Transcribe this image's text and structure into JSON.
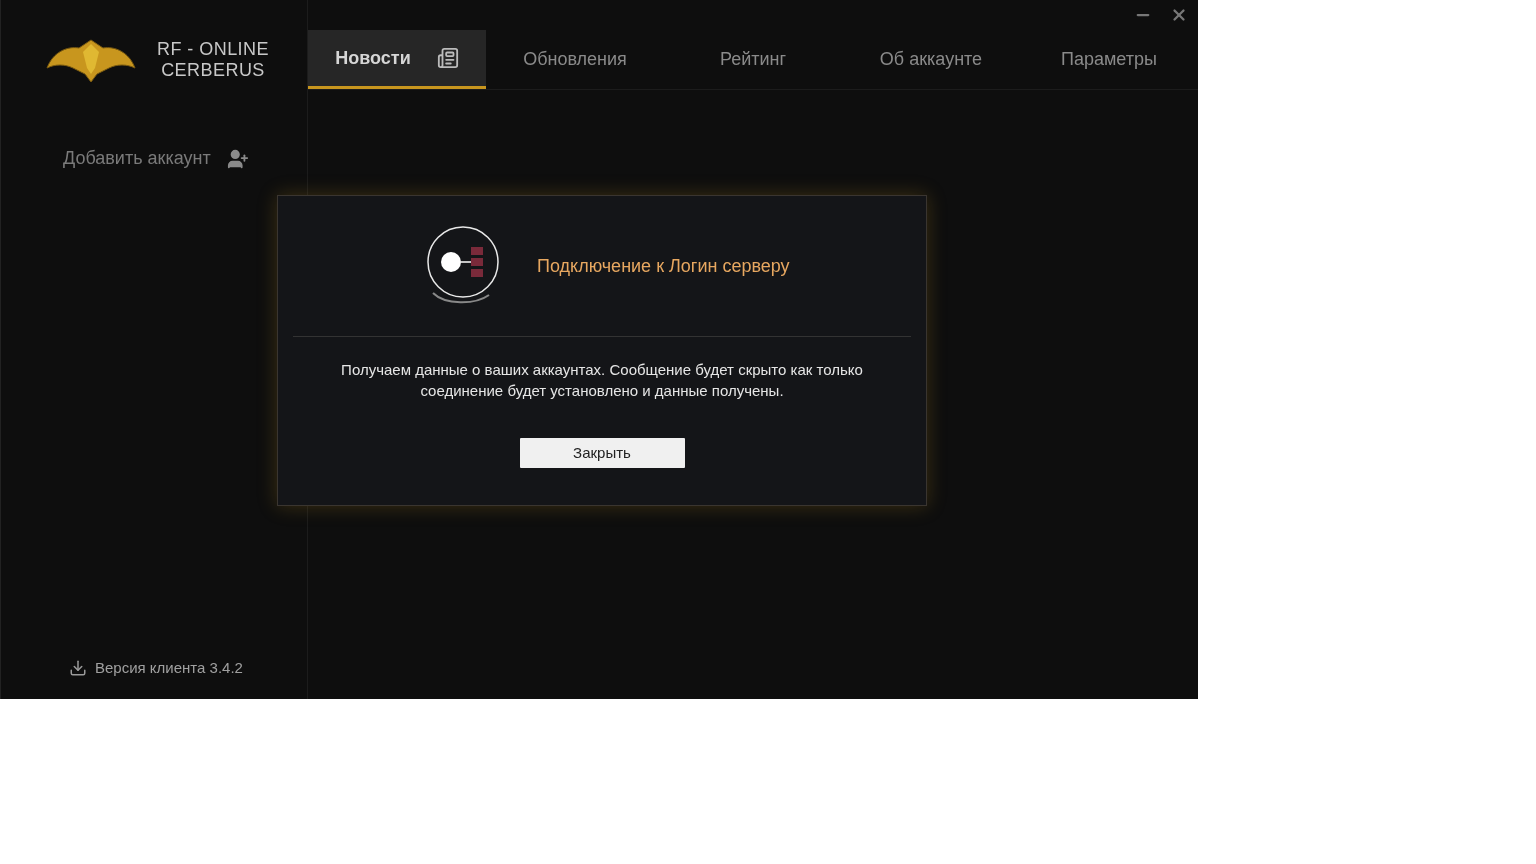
{
  "logo": {
    "line1": "RF - ONLINE",
    "line2": "CERBERUS"
  },
  "tabs": [
    {
      "label": "Новости",
      "selected": true,
      "icon": true
    },
    {
      "label": "Обновления",
      "selected": false,
      "icon": false
    },
    {
      "label": "Рейтинг",
      "selected": false,
      "icon": false
    },
    {
      "label": "Об аккаунте",
      "selected": false,
      "icon": false
    },
    {
      "label": "Параметры",
      "selected": false,
      "icon": false
    }
  ],
  "sidebar": {
    "add_account": "Добавить аккаунт",
    "version": "Версия клиента 3.4.2"
  },
  "dialog": {
    "title": "Подключение к Логин серверу",
    "message": "Получаем данные о ваших аккаунтах. Сообщение будет скрыто как только соединение будет установлено и данные получены.",
    "button": "Закрыть"
  }
}
